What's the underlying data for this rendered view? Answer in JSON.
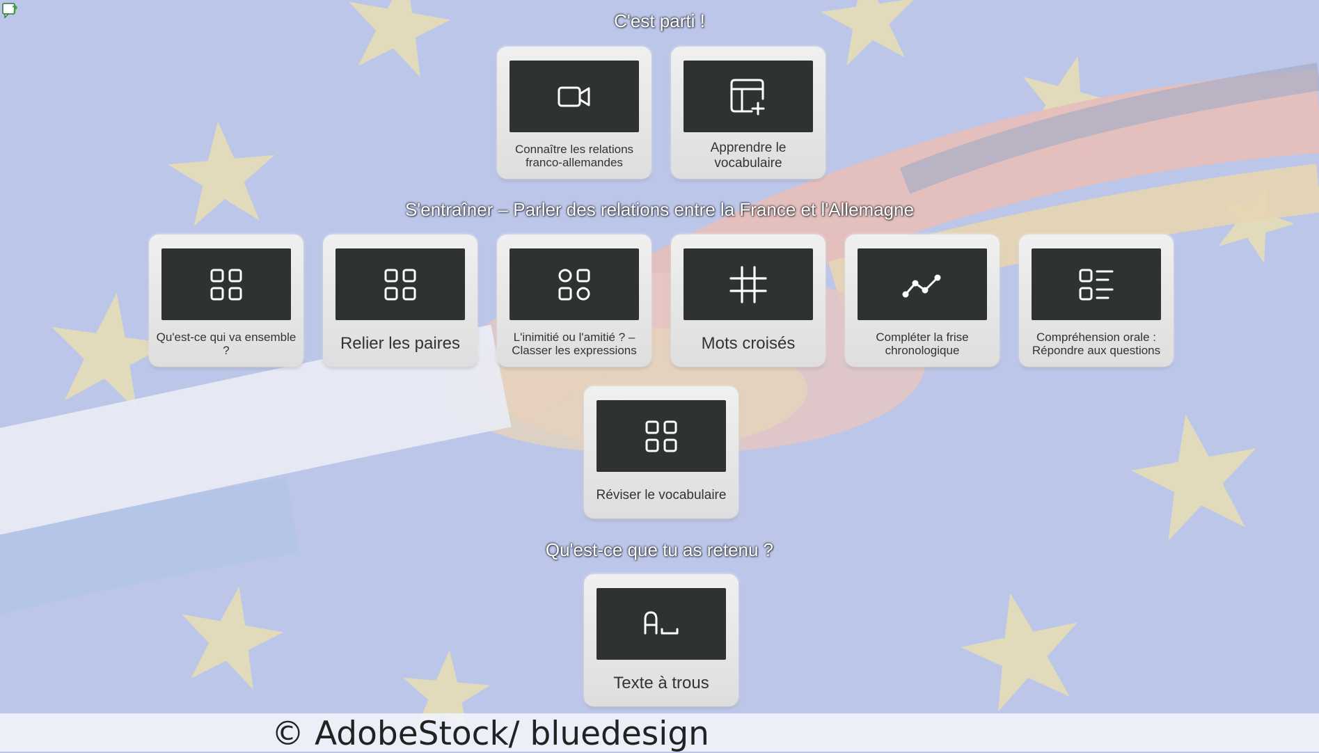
{
  "colors": {
    "background_blue": "#b9c4e6",
    "star_yellow": "#f2e6a0",
    "tile_icon_bg": "#2f3233",
    "tile_bg": "#e8e8e8",
    "heading_text": "#ffffff"
  },
  "sections": [
    {
      "heading": "C'est parti !",
      "tiles": [
        {
          "label": "Connaître les relations franco-allemandes",
          "icon": "video-camera-icon"
        },
        {
          "label": "Apprendre le vocabulaire",
          "icon": "table-add-icon"
        }
      ]
    },
    {
      "heading": "S'entraîner – Parler des relations entre la France et l'Allemagne",
      "tiles": [
        {
          "label": "Qu'est-ce qui va ensemble ?",
          "icon": "grid-squares-icon"
        },
        {
          "label": "Relier les paires",
          "icon": "grid-squares-icon"
        },
        {
          "label": "L'inimitié ou l'amitié ? – Classer les expressions",
          "icon": "shapes-sort-icon"
        },
        {
          "label": "Mots croisés",
          "icon": "hashtag-icon"
        },
        {
          "label": "Compléter la frise chronologique",
          "icon": "line-chart-icon"
        },
        {
          "label": "Compréhension orale : Répondre aux questions",
          "icon": "question-list-icon"
        },
        {
          "label": "Réviser le vocabulaire",
          "icon": "grid-squares-icon"
        }
      ]
    },
    {
      "heading": "Qu'est-ce que tu as retenu ?",
      "tiles": [
        {
          "label": "Texte à trous",
          "icon": "text-gap-icon"
        }
      ]
    }
  ],
  "footer": {
    "credit": "© AdobeStock/ bluedesign"
  }
}
